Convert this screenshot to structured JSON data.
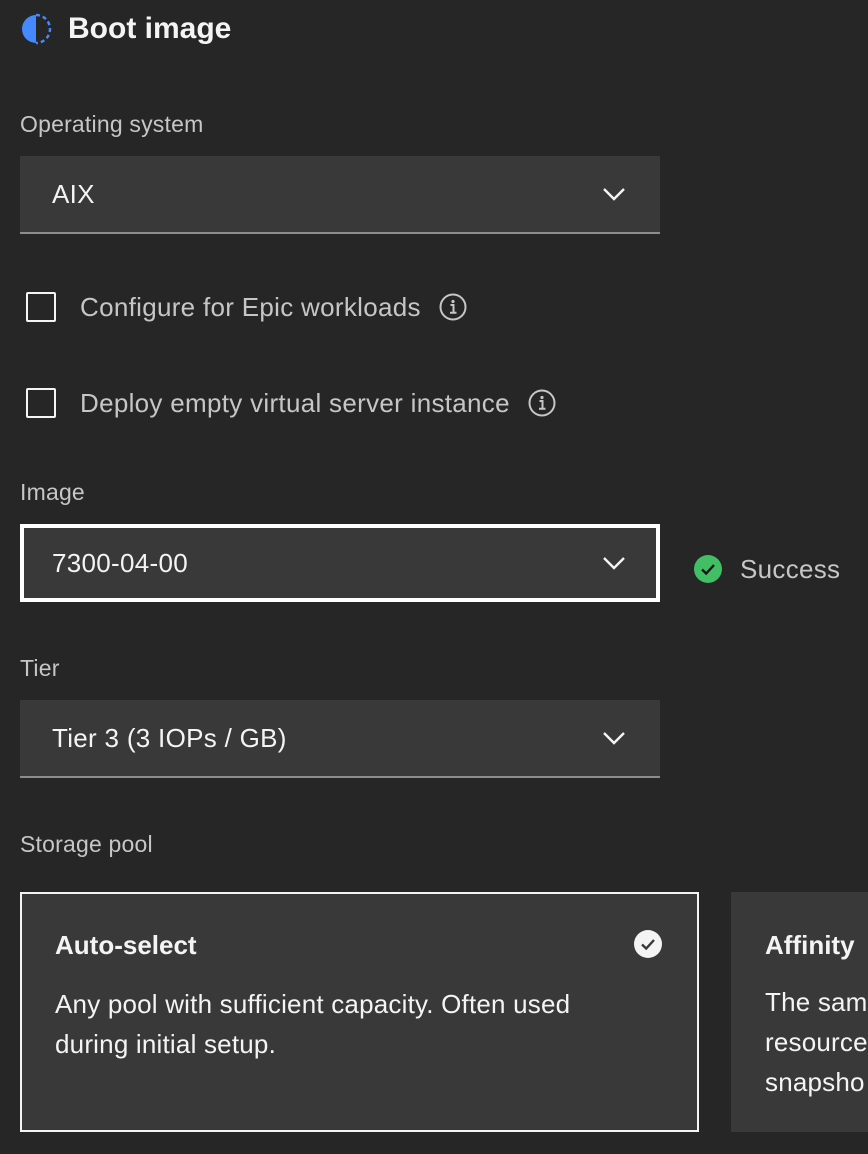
{
  "section": {
    "title": "Boot image",
    "icon": "half-moon-icon"
  },
  "operating_system": {
    "label": "Operating system",
    "value": "AIX"
  },
  "checkboxes": [
    {
      "label": "Configure for Epic workloads",
      "checked": false
    },
    {
      "label": "Deploy empty virtual server instance",
      "checked": false
    }
  ],
  "image": {
    "label": "Image",
    "value": "7300-04-00",
    "status": "Success",
    "status_color": "#42be65"
  },
  "tier": {
    "label": "Tier",
    "value": "Tier 3 (3 IOPs / GB)"
  },
  "storage_pool": {
    "label": "Storage pool",
    "tiles": [
      {
        "title": "Auto-select",
        "description": "Any pool with sufficient capacity. Often used during initial setup.",
        "selected": true
      },
      {
        "title": "Affinity",
        "description": "The sam\nresource\nsnapsho",
        "selected": false
      }
    ]
  },
  "colors": {
    "background": "#262626",
    "field": "#393939",
    "accent": "#4589ff"
  }
}
